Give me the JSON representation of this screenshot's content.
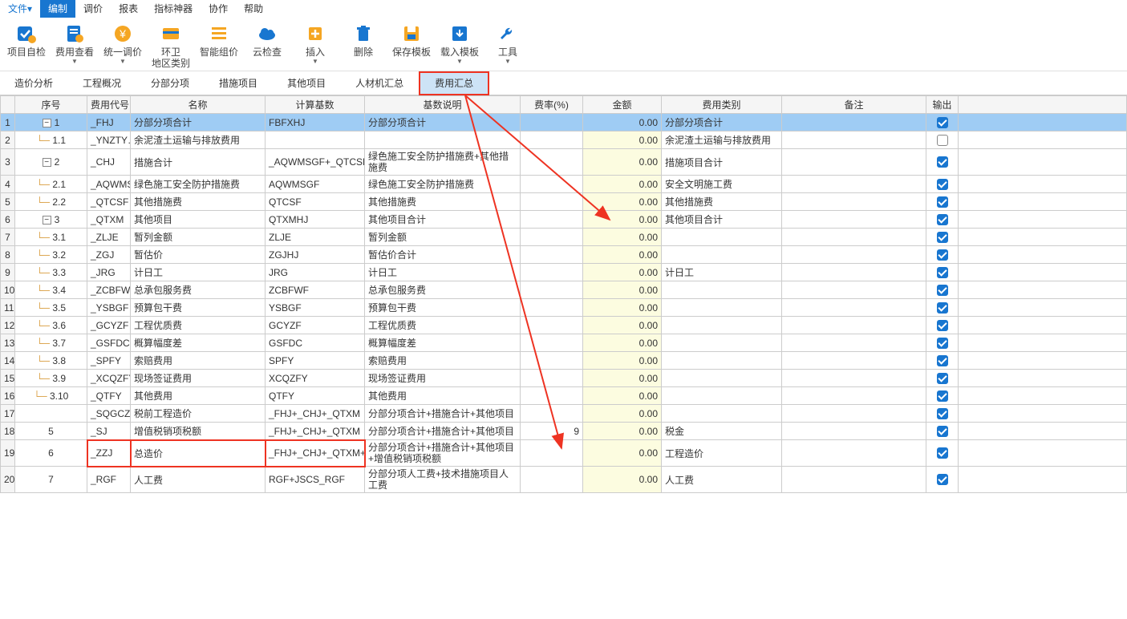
{
  "menu": {
    "file": "文件▾",
    "edit": "编制",
    "tiaojia": "调价",
    "report": "报表",
    "zhibiao": "指标神器",
    "xiezuo": "协作",
    "help": "帮助"
  },
  "tools": [
    {
      "name": "xm-self-check",
      "label": "项目自检",
      "glyph": "check"
    },
    {
      "name": "fee-view",
      "label": "费用查看",
      "glyph": "doc",
      "caret": true
    },
    {
      "name": "unified-price",
      "label": "统一调价",
      "glyph": "price",
      "caret": true
    },
    {
      "name": "area-type",
      "label": "环卫\n地区类别",
      "glyph": "card"
    },
    {
      "name": "smart-group",
      "label": "智能组价",
      "glyph": "list"
    },
    {
      "name": "cloud-check",
      "label": "云检查",
      "glyph": "cloud"
    },
    {
      "name": "insert",
      "label": "插入",
      "glyph": "insert",
      "caret": true
    },
    {
      "name": "delete",
      "label": "删除",
      "glyph": "trash"
    },
    {
      "name": "save-tpl",
      "label": "保存模板",
      "glyph": "save"
    },
    {
      "name": "load-tpl",
      "label": "载入模板",
      "glyph": "load",
      "caret": true
    },
    {
      "name": "tool",
      "label": "工具",
      "glyph": "wrench",
      "caret": true
    }
  ],
  "tabs": [
    {
      "id": "cost-analysis",
      "label": "造价分析"
    },
    {
      "id": "project-overview",
      "label": "工程概况"
    },
    {
      "id": "sections",
      "label": "分部分项"
    },
    {
      "id": "measures",
      "label": "措施项目"
    },
    {
      "id": "other",
      "label": "其他项目"
    },
    {
      "id": "materials",
      "label": "人材机汇总"
    },
    {
      "id": "fee-summary",
      "label": "费用汇总",
      "active": true
    }
  ],
  "header": {
    "rownum": "",
    "seq": "序号",
    "code": "费用代号",
    "name": "名称",
    "formula": "计算基数",
    "basis": "基数说明",
    "rate": "费率(%)",
    "amt": "金额",
    "cat": "费用类别",
    "remark": "备注",
    "out": "输出"
  },
  "rows": [
    {
      "n": "1",
      "seq": "1",
      "level": 0,
      "toggle": true,
      "code": "_FHJ",
      "name": "分部分项合计",
      "formula": "FBFXHJ",
      "basis": "分部分项合计",
      "rate": "",
      "amt": "0.00",
      "cat": "分部分项合计",
      "out": true,
      "selected": true
    },
    {
      "n": "2",
      "seq": "1.1",
      "level": 1,
      "code": "_YNZTY…",
      "name": "余泥渣土运输与排放费用",
      "formula": "",
      "basis": "",
      "rate": "",
      "amt": "0.00",
      "cat": "余泥渣土运输与排放费用",
      "out": false
    },
    {
      "n": "3",
      "seq": "2",
      "level": 0,
      "toggle": true,
      "code": "_CHJ",
      "name": "措施合计",
      "formula": "_AQWMSGF+_QTCSF",
      "basis": "绿色施工安全防护措施费+其他措施费",
      "rate": "",
      "amt": "0.00",
      "cat": "措施项目合计",
      "out": true
    },
    {
      "n": "4",
      "seq": "2.1",
      "level": 1,
      "code": "_AQWMSGF",
      "name": "绿色施工安全防护措施费",
      "formula": "AQWMSGF",
      "basis": "绿色施工安全防护措施费",
      "rate": "",
      "amt": "0.00",
      "cat": "安全文明施工费",
      "out": true
    },
    {
      "n": "5",
      "seq": "2.2",
      "level": 1,
      "code": "_QTCSF",
      "name": "其他措施费",
      "formula": "QTCSF",
      "basis": "其他措施费",
      "rate": "",
      "amt": "0.00",
      "cat": "其他措施费",
      "out": true
    },
    {
      "n": "6",
      "seq": "3",
      "level": 0,
      "toggle": true,
      "code": "_QTXM",
      "name": "其他项目",
      "formula": "QTXMHJ",
      "basis": "其他项目合计",
      "rate": "",
      "amt": "0.00",
      "cat": "其他项目合计",
      "out": true
    },
    {
      "n": "7",
      "seq": "3.1",
      "level": 1,
      "code": "_ZLJE",
      "name": "暂列金额",
      "formula": "ZLJE",
      "basis": "暂列金额",
      "rate": "",
      "amt": "0.00",
      "cat": "",
      "out": true
    },
    {
      "n": "8",
      "seq": "3.2",
      "level": 1,
      "code": "_ZGJ",
      "name": "暂估价",
      "formula": "ZGJHJ",
      "basis": "暂估价合计",
      "rate": "",
      "amt": "0.00",
      "cat": "",
      "out": true
    },
    {
      "n": "9",
      "seq": "3.3",
      "level": 1,
      "code": "_JRG",
      "name": "计日工",
      "formula": "JRG",
      "basis": "计日工",
      "rate": "",
      "amt": "0.00",
      "cat": "计日工",
      "out": true
    },
    {
      "n": "10",
      "seq": "3.4",
      "level": 1,
      "code": "_ZCBFWF",
      "name": "总承包服务费",
      "formula": "ZCBFWF",
      "basis": "总承包服务费",
      "rate": "",
      "amt": "0.00",
      "cat": "",
      "out": true
    },
    {
      "n": "11",
      "seq": "3.5",
      "level": 1,
      "code": "_YSBGF",
      "name": "预算包干费",
      "formula": "YSBGF",
      "basis": "预算包干费",
      "rate": "",
      "amt": "0.00",
      "cat": "",
      "out": true
    },
    {
      "n": "12",
      "seq": "3.6",
      "level": 1,
      "code": "_GCYZF",
      "name": "工程优质费",
      "formula": "GCYZF",
      "basis": "工程优质费",
      "rate": "",
      "amt": "0.00",
      "cat": "",
      "out": true
    },
    {
      "n": "13",
      "seq": "3.7",
      "level": 1,
      "code": "_GSFDC",
      "name": "概算幅度差",
      "formula": "GSFDC",
      "basis": "概算幅度差",
      "rate": "",
      "amt": "0.00",
      "cat": "",
      "out": true
    },
    {
      "n": "14",
      "seq": "3.8",
      "level": 1,
      "code": "_SPFY",
      "name": "索赔费用",
      "formula": "SPFY",
      "basis": "索赔费用",
      "rate": "",
      "amt": "0.00",
      "cat": "",
      "out": true
    },
    {
      "n": "15",
      "seq": "3.9",
      "level": 1,
      "code": "_XCQZFY",
      "name": "现场签证费用",
      "formula": "XCQZFY",
      "basis": "现场签证费用",
      "rate": "",
      "amt": "0.00",
      "cat": "",
      "out": true
    },
    {
      "n": "16",
      "seq": "3.10",
      "level": 1,
      "code": "_QTFY",
      "name": "其他费用",
      "formula": "QTFY",
      "basis": "其他费用",
      "rate": "",
      "amt": "0.00",
      "cat": "",
      "out": true
    },
    {
      "n": "17",
      "seq": "",
      "level": 0,
      "code": "_SQGCZJ",
      "name": "税前工程造价",
      "formula": "_FHJ+_CHJ+_QTXM",
      "basis": "分部分项合计+措施合计+其他项目",
      "rate": "",
      "amt": "0.00",
      "cat": "",
      "out": true
    },
    {
      "n": "18",
      "seq": "5",
      "level": 0,
      "code": "_SJ",
      "name": "增值税销项税额",
      "formula": "_FHJ+_CHJ+_QTXM",
      "basis": "分部分项合计+措施合计+其他项目",
      "rate": "9",
      "amt": "0.00",
      "cat": "税金",
      "out": true
    },
    {
      "n": "19",
      "seq": "6",
      "level": 0,
      "code": "_ZZJ",
      "name": "总造价",
      "formula": "_FHJ+_CHJ+_QTXM+_SJ",
      "basis": "分部分项合计+措施合计+其他项目+增值税销项税额",
      "rate": "",
      "amt": "0.00",
      "cat": "工程造价",
      "out": true,
      "redbox": true
    },
    {
      "n": "20",
      "seq": "7",
      "level": 0,
      "code": "_RGF",
      "name": "人工费",
      "formula": "RGF+JSCS_RGF",
      "basis": "分部分项人工费+技术措施项目人工费",
      "rate": "",
      "amt": "0.00",
      "cat": "人工费",
      "out": true
    }
  ]
}
